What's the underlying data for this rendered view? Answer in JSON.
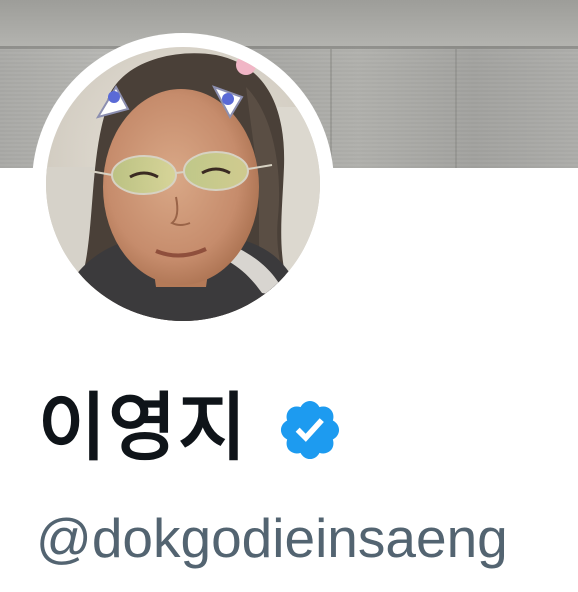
{
  "profile": {
    "display_name": "이영지",
    "handle": "@dokgodieinsaeng",
    "verified": true
  },
  "icons": {
    "verified": "verified-badge-icon"
  },
  "colors": {
    "name_text": "#0f1419",
    "handle_text": "#536471",
    "verified_badge": "#1d9bf0",
    "background": "#ffffff"
  }
}
